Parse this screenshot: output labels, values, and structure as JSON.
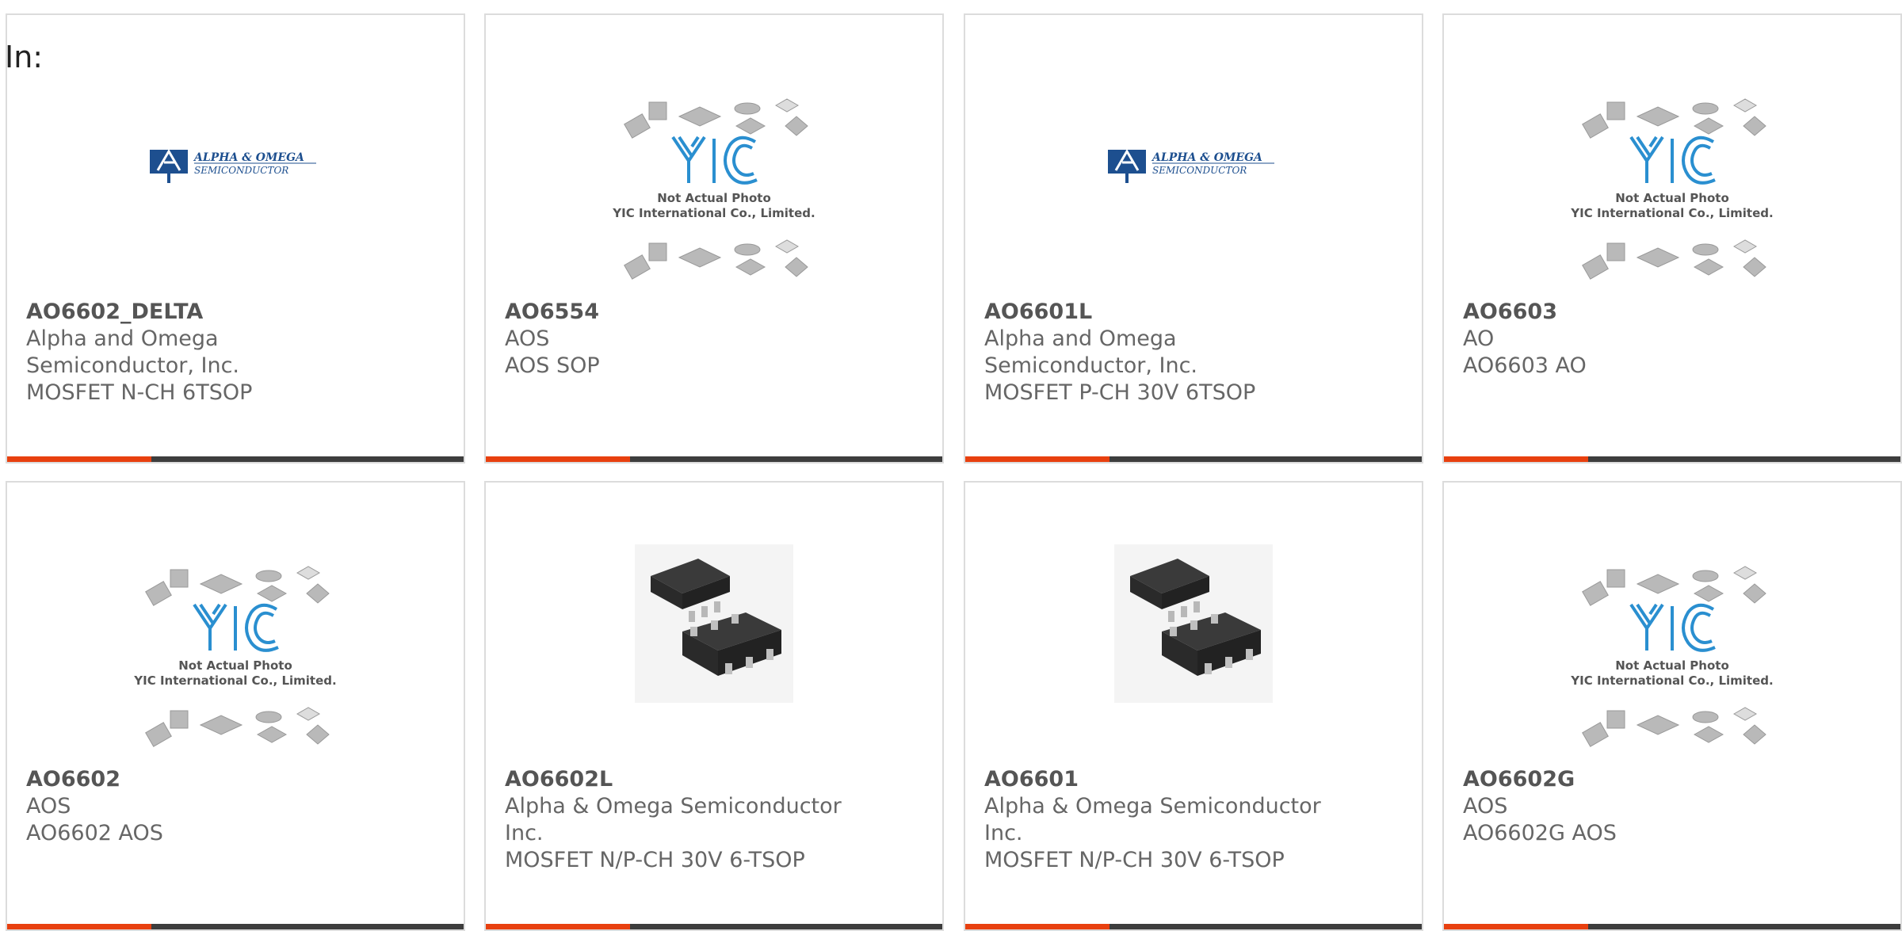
{
  "prefix": "In:",
  "products": [
    {
      "part": "AO6602_DELTA",
      "maker": "Alpha and Omega Semiconductor, Inc.",
      "desc": "MOSFET N-CH 6TSOP",
      "image": "alpha-omega-logo",
      "logo_text1": "ALPHA & OMEGA",
      "logo_text2": "SEMICONDUCTOR"
    },
    {
      "part": "AO6554",
      "maker": "AOS",
      "desc": "AOS SOP",
      "image": "yic-placeholder",
      "placeholder_line1": "Not Actual Photo",
      "placeholder_line2": "YIC International Co., Limited."
    },
    {
      "part": "AO6601L",
      "maker": "Alpha and Omega Semiconductor, Inc.",
      "desc": "MOSFET P-CH 30V 6TSOP",
      "image": "alpha-omega-logo",
      "logo_text1": "ALPHA & OMEGA",
      "logo_text2": "SEMICONDUCTOR"
    },
    {
      "part": "AO6603",
      "maker": "AO",
      "desc": "AO6603 AO",
      "image": "yic-placeholder",
      "placeholder_line1": "Not Actual Photo",
      "placeholder_line2": "YIC International Co., Limited."
    },
    {
      "part": "AO6602",
      "maker": "AOS",
      "desc": "AO6602 AOS",
      "image": "yic-placeholder",
      "placeholder_line1": "Not Actual Photo",
      "placeholder_line2": "YIC International Co., Limited."
    },
    {
      "part": "AO6602L",
      "maker": "Alpha & Omega Semiconductor Inc.",
      "desc": "MOSFET N/P-CH 30V 6-TSOP",
      "image": "tsop-chip-photo"
    },
    {
      "part": "AO6601",
      "maker": "Alpha & Omega Semiconductor Inc.",
      "desc": "MOSFET N/P-CH 30V 6-TSOP",
      "image": "tsop-chip-photo"
    },
    {
      "part": "AO6602G",
      "maker": "AOS",
      "desc": "AO6602G AOS",
      "image": "yic-placeholder",
      "placeholder_line1": "Not Actual Photo",
      "placeholder_line2": "YIC International Co., Limited."
    }
  ],
  "colors": {
    "accent": "#e8400f",
    "bar": "#3d3d3d",
    "border": "#dcdcdc",
    "yic_blue": "#2a8fd0",
    "logo_blue": "#1d4f8f"
  }
}
